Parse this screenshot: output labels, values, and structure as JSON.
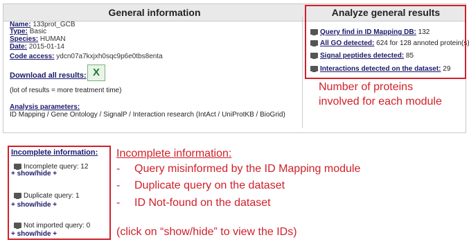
{
  "general": {
    "title": "General information",
    "fields": [
      {
        "label": "Name:",
        "value": " 133prot_GCB"
      },
      {
        "label": "Type:",
        "value": " Basic"
      },
      {
        "label": "Species:",
        "value": " HUMAN"
      },
      {
        "label": "Date:",
        "value": " 2015-01-14"
      },
      {
        "label": "Code access:",
        "value": " ydcn07a7kxjxh0sqc9p6e0tbs8enta"
      }
    ],
    "download_label": "Download all results:",
    "excel_icon": "excel-icon",
    "note": "(lot of results = more treatment time)",
    "params_label": "Analysis parameters:",
    "params_value": "ID Mapping / Gene Ontology / SignalP / Interaction research (IntAct / UniProtKB / BioGrid)"
  },
  "analyze": {
    "title": "Analyze general results",
    "items": [
      {
        "label": "Query find in ID Mapping DB:",
        "value": " 132"
      },
      {
        "label": "All GO detected:",
        "value": " 624 for 128 annoted protein(s)"
      },
      {
        "label": "Signal peptides detected:",
        "value": " 85"
      },
      {
        "label": "Interactions detected on the dataset:",
        "value": " 29"
      }
    ]
  },
  "annotations": {
    "num_proteins_line1": "Number of proteins",
    "num_proteins_line2": "involved for each module",
    "incomplete_heading": "Incomplete information:",
    "dash": "-",
    "bullets": [
      "Query misinformed by the ID Mapping module",
      "Duplicate query on the dataset",
      "ID Not-found on the dataset"
    ],
    "footer": "(click on “show/hide” to view the IDs)"
  },
  "incomplete": {
    "title": "Incomplete information:",
    "items": [
      {
        "text": "Incomplete query: 12",
        "toggle": "+ show/hide +"
      },
      {
        "text": "Duplicate query: 1",
        "toggle": "+ show/hide +"
      },
      {
        "text": "Not imported query: 0",
        "toggle": "+ show/hide +"
      }
    ]
  },
  "colors": {
    "accent_red": "#d0202a",
    "header_bg": "#e9e9e9",
    "link": "#1a1a6b"
  }
}
